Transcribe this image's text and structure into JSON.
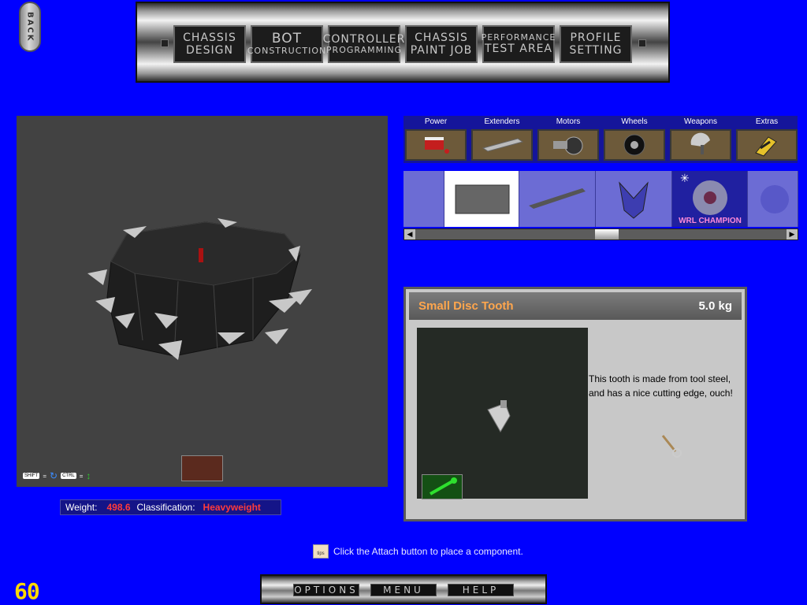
{
  "back_label": "BACK",
  "top_menu": [
    {
      "line1": "CHASSIS",
      "line2": "DESIGN"
    },
    {
      "line1": "BOT",
      "line2": "CONSTRUCTION"
    },
    {
      "line1": "CONTROLLER",
      "line2": "PROGRAMMING"
    },
    {
      "line1": "CHASSIS",
      "line2": "PAINT JOB"
    },
    {
      "line1": "PERFORMANCE",
      "line2": "TEST AREA"
    },
    {
      "line1": "PROFILE",
      "line2": "SETTING"
    }
  ],
  "viewport": {
    "hint_shift": "SHIFT",
    "hint_ctrl": "CTRL",
    "equals": "="
  },
  "stats": {
    "weight_label": "Weight:",
    "weight_value": "498.6",
    "class_label": "Classification:",
    "class_value": "Heavyweight"
  },
  "categories": [
    {
      "label": "Power",
      "icon": "battery-icon"
    },
    {
      "label": "Extenders",
      "icon": "extender-bar-icon"
    },
    {
      "label": "Motors",
      "icon": "motor-icon"
    },
    {
      "label": "Wheels",
      "icon": "wheel-icon"
    },
    {
      "label": "Weapons",
      "icon": "weapon-icon"
    },
    {
      "label": "Extras",
      "icon": "extras-icon"
    }
  ],
  "strip": {
    "champion_label": "WRL CHAMPION"
  },
  "info": {
    "name": "Small Disc Tooth",
    "weight": "5.0 kg",
    "description": "This tooth is made from tool steel, and has a nice cutting edge, ouch!"
  },
  "tip": {
    "icon_label": "tips",
    "text": "Click the Attach button to place a component."
  },
  "bottom_menu": [
    "OPTIONS",
    "MENU",
    "HELP"
  ],
  "fps": "60",
  "colors": {
    "background": "#0000ff",
    "accent_orange": "#ffa64d",
    "stat_red": "#ff3b3b",
    "fps_yellow": "#ffd800"
  }
}
